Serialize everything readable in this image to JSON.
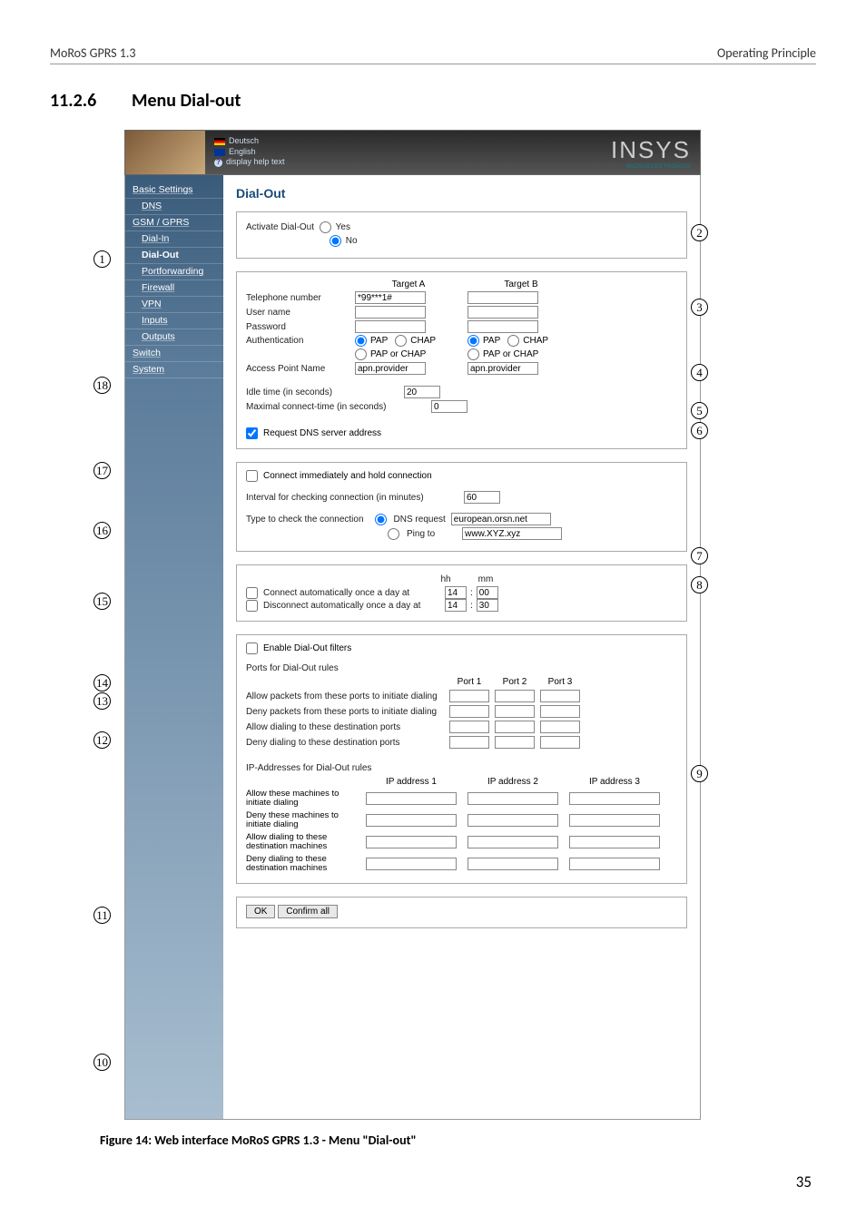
{
  "header": {
    "left": "MoRoS GPRS 1.3",
    "right": "Operating Principle"
  },
  "section": {
    "number": "11.2.6",
    "title": "Menu Dial-out"
  },
  "topbar": {
    "lang_de": "Deutsch",
    "lang_en": "English",
    "help": "display help text",
    "logo_big": "INSYS",
    "logo_small": "MICROELECTRONICS"
  },
  "sidebar": {
    "items": [
      {
        "label": "Basic Settings",
        "sub": false
      },
      {
        "label": "DNS",
        "sub": true
      },
      {
        "label": "GSM / GPRS",
        "sub": false
      },
      {
        "label": "Dial-In",
        "sub": true
      },
      {
        "label": "Dial-Out",
        "sub": true,
        "active": true
      },
      {
        "label": "Portforwarding",
        "sub": true
      },
      {
        "label": "Firewall",
        "sub": true
      },
      {
        "label": "VPN",
        "sub": true
      },
      {
        "label": "Inputs",
        "sub": true
      },
      {
        "label": "Outputs",
        "sub": true
      },
      {
        "label": "Switch",
        "sub": false
      },
      {
        "label": "System",
        "sub": false
      }
    ]
  },
  "main": {
    "title": "Dial-Out",
    "activate_label": "Activate Dial-Out",
    "yes": "Yes",
    "no": "No",
    "targetA": "Target A",
    "targetB": "Target B",
    "tel_label": "Telephone number",
    "tel_a": "*99***1#",
    "user_label": "User name",
    "pass_label": "Password",
    "auth_label": "Authentication",
    "pap": "PAP",
    "chap": "CHAP",
    "paporchap": "PAP or CHAP",
    "apn_label": "Access Point Name",
    "apn_a": "apn.provider",
    "apn_b": "apn.provider",
    "idle_label": "Idle time (in seconds)",
    "idle_val": "20",
    "maxconn_label": "Maximal connect-time (in seconds)",
    "maxconn_val": "0",
    "reqdns": "Request DNS server address",
    "connhold": "Connect immediately and hold connection",
    "interval_label": "Interval for checking connection (in minutes)",
    "interval_val": "60",
    "type_label": "Type to check the connection",
    "dnsreq": "DNS request",
    "dns_val": "european.orsn.net",
    "pingto": "Ping to",
    "ping_val": "www.XYZ.xyz",
    "hh": "hh",
    "mm": "mm",
    "conn_once": "Connect automatically once a day at",
    "conn_hh": "14",
    "conn_mm": "00",
    "disc_once": "Disconnect automatically once a day at",
    "disc_hh": "14",
    "disc_mm": "30",
    "enable_filters": "Enable Dial-Out filters",
    "ports_title": "Ports for Dial-Out rules",
    "port1": "Port 1",
    "port2": "Port 2",
    "port3": "Port 3",
    "allow_from": "Allow packets from these ports to initiate dialing",
    "deny_from": "Deny packets from these ports to initiate dialing",
    "allow_to": "Allow dialing to these destination ports",
    "deny_to": "Deny dialing to these destination ports",
    "ips_title": "IP-Addresses for Dial-Out rules",
    "ip1": "IP address 1",
    "ip2": "IP address 2",
    "ip3": "IP address 3",
    "allow_mach_from": "Allow these machines to initiate dialing",
    "deny_mach_from": "Deny these machines to initiate dialing",
    "allow_mach_to": "Allow dialing to these destination machines",
    "deny_mach_to": "Deny dialing to these destination machines",
    "ok": "OK",
    "confirm": "Confirm all"
  },
  "caption": "Figure 14: Web interface MoRoS GPRS 1.3 - Menu \"Dial-out\"",
  "pagenum": "35",
  "callouts": {
    "c1": "1",
    "c2": "2",
    "c3": "3",
    "c4": "4",
    "c5": "5",
    "c6": "6",
    "c7": "7",
    "c8": "8",
    "c9": "9",
    "c10": "10",
    "c11": "11",
    "c12": "12",
    "c13": "13",
    "c14": "14",
    "c15": "15",
    "c16": "16",
    "c17": "17",
    "c18": "18"
  }
}
